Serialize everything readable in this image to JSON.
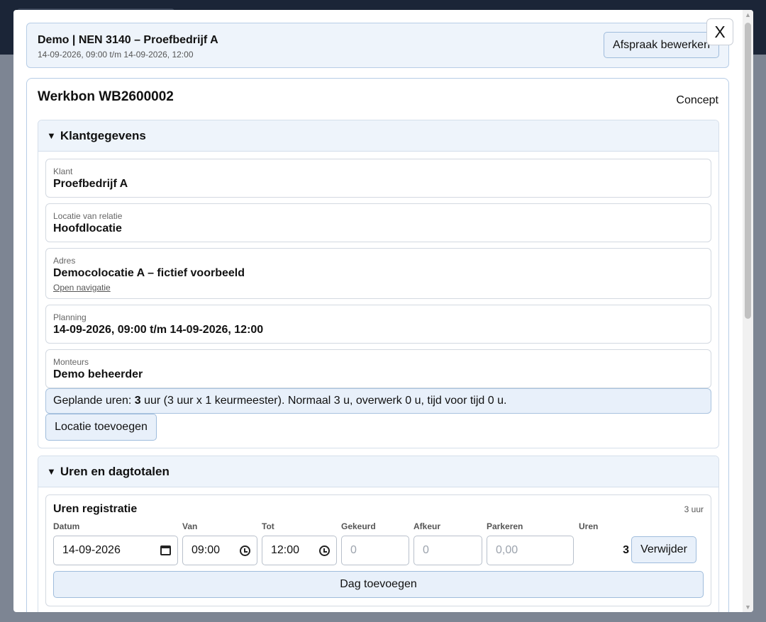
{
  "appointment": {
    "title": "Demo | NEN 3140 – Proefbedrijf A",
    "subtitle": "14-09-2026, 09:00 t/m 14-09-2026, 12:00",
    "edit_button": "Afspraak bewerken"
  },
  "close_label": "X",
  "workorder": {
    "title": "Werkbon WB2600002",
    "status": "Concept"
  },
  "klantgegevens": {
    "heading": "Klantgegevens",
    "fields": [
      {
        "label": "Klant",
        "value": "Proefbedrijf A"
      },
      {
        "label": "Locatie van relatie",
        "value": "Hoofdlocatie"
      },
      {
        "label": "Adres",
        "value": "Democolocatie A – fictief voorbeeld",
        "link": "Open navigatie"
      },
      {
        "label": "Planning",
        "value": "14-09-2026, 09:00 t/m 14-09-2026, 12:00"
      },
      {
        "label": "Monteurs",
        "value": "Demo beheerder"
      }
    ],
    "planned_prefix": "Geplande uren: ",
    "planned_hours": "3",
    "planned_suffix": " uur (3 uur x 1 keurmeester). Normaal 3 u, overwerk 0 u, tijd voor tijd 0 u.",
    "add_location_button": "Locatie toevoegen"
  },
  "uren": {
    "heading": "Uren en dagtotalen",
    "registration_title": "Uren registratie",
    "total": "3 uur",
    "columns": {
      "datum": "Datum",
      "van": "Van",
      "tot": "Tot",
      "gekeurd": "Gekeurd",
      "afkeur": "Afkeur",
      "parkeren": "Parkeren",
      "uren": "Uren"
    },
    "row": {
      "datum": "14-09-2026",
      "van": "09:00",
      "tot": "12:00",
      "gekeurd_placeholder": "0",
      "afkeur_placeholder": "0",
      "parkeren_placeholder": "0,00",
      "uren": "3",
      "delete_button": "Verwijder"
    },
    "add_day_button": "Dag toevoegen"
  },
  "icons": {
    "section_toggle": "triangle-down-icon",
    "date": "calendar-icon",
    "time": "clock-icon"
  }
}
